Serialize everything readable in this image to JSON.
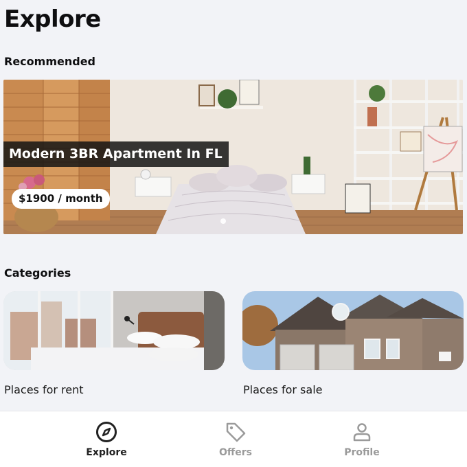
{
  "page": {
    "title": "Explore"
  },
  "recommended": {
    "heading": "Recommended",
    "card": {
      "title": "Modern 3BR Apartment In FL",
      "price": "$1900 / month"
    }
  },
  "categories": {
    "heading": "Categories",
    "items": [
      {
        "label": "Places for rent"
      },
      {
        "label": "Places for sale"
      }
    ]
  },
  "bottom_nav": {
    "items": [
      {
        "label": "Explore",
        "icon": "compass-icon",
        "active": true
      },
      {
        "label": "Offers",
        "icon": "tag-icon",
        "active": false
      },
      {
        "label": "Profile",
        "icon": "person-icon",
        "active": false
      }
    ]
  },
  "colors": {
    "background": "#f2f3f7",
    "active_nav": "#222222",
    "inactive_nav": "#9a9a9a"
  }
}
